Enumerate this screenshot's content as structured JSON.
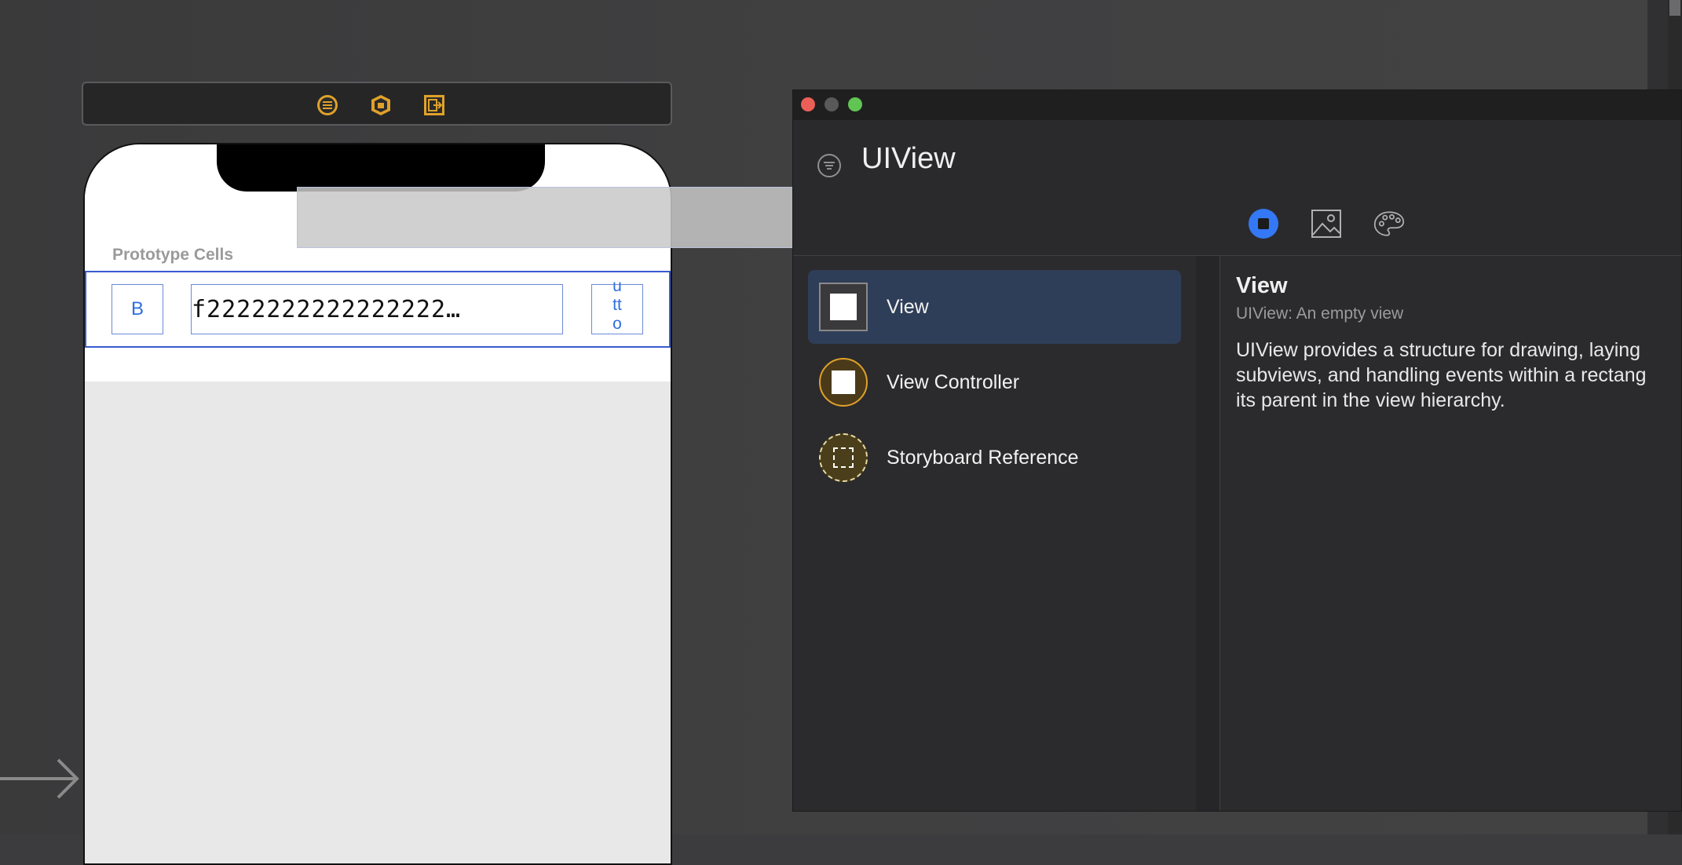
{
  "scene_toolbar": {
    "icons": [
      "first-responder-icon",
      "view-controller-cube-icon",
      "exit-icon"
    ]
  },
  "canvas": {
    "section_label": "Prototype Cells",
    "cell": {
      "left_button_label": "B",
      "text_label": "f2222222222222222…",
      "right_button_lines": [
        "u",
        "tt",
        "o"
      ]
    }
  },
  "library": {
    "title": "UIView",
    "tabs": [
      "objects-icon",
      "media-icon",
      "colors-icon"
    ],
    "items": [
      {
        "label": "View",
        "icon": "view-square-icon",
        "selected": true
      },
      {
        "label": "View Controller",
        "icon": "view-controller-icon",
        "selected": false
      },
      {
        "label": "Storyboard Reference",
        "icon": "storyboard-reference-icon",
        "selected": false
      }
    ],
    "detail": {
      "title": "View",
      "subtitle": "UIView: An empty view",
      "body_lines": [
        "UIView provides a structure for drawing, laying",
        "subviews, and handling events within a rectang",
        "its parent in the view hierarchy."
      ]
    }
  },
  "colors": {
    "accent_blue": "#3478f6",
    "selection_bg": "#2f3e58",
    "cell_outline": "#3a5bd0",
    "icon_orange": "#e0a12a"
  }
}
